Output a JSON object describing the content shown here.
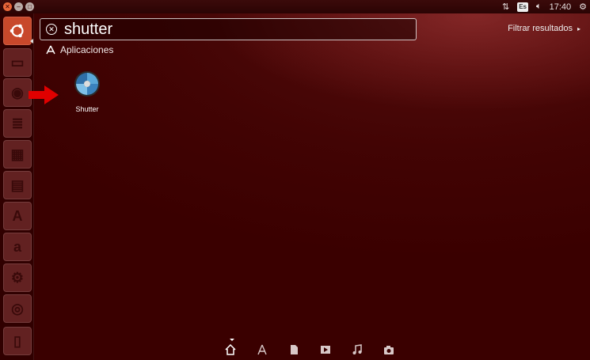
{
  "top_panel": {
    "keyboard_layout": "Es",
    "clock": "17:40",
    "icons": [
      "network-icon",
      "keyboard-layout-icon",
      "volume-icon",
      "settings-icon"
    ]
  },
  "window_buttons": [
    "close",
    "minimize",
    "maximize"
  ],
  "search": {
    "query": "shutter",
    "filter_label": "Filtrar resultados"
  },
  "results": {
    "category_label": "Aplicaciones",
    "items": [
      {
        "label": "Shutter",
        "icon": "shutter-app-icon"
      }
    ]
  },
  "launcher": {
    "items": [
      "ubuntu-dash",
      "file-manager",
      "firefox",
      "libreoffice-writer",
      "libreoffice-calc",
      "libreoffice-impress",
      "software-center",
      "amazon",
      "system-settings",
      "disk",
      "trash"
    ]
  },
  "lenses": [
    "home",
    "applications",
    "files",
    "video",
    "music",
    "photos"
  ],
  "colors": {
    "background": "#3a0000",
    "accent": "#c8482b",
    "arrow": "#e00000"
  }
}
